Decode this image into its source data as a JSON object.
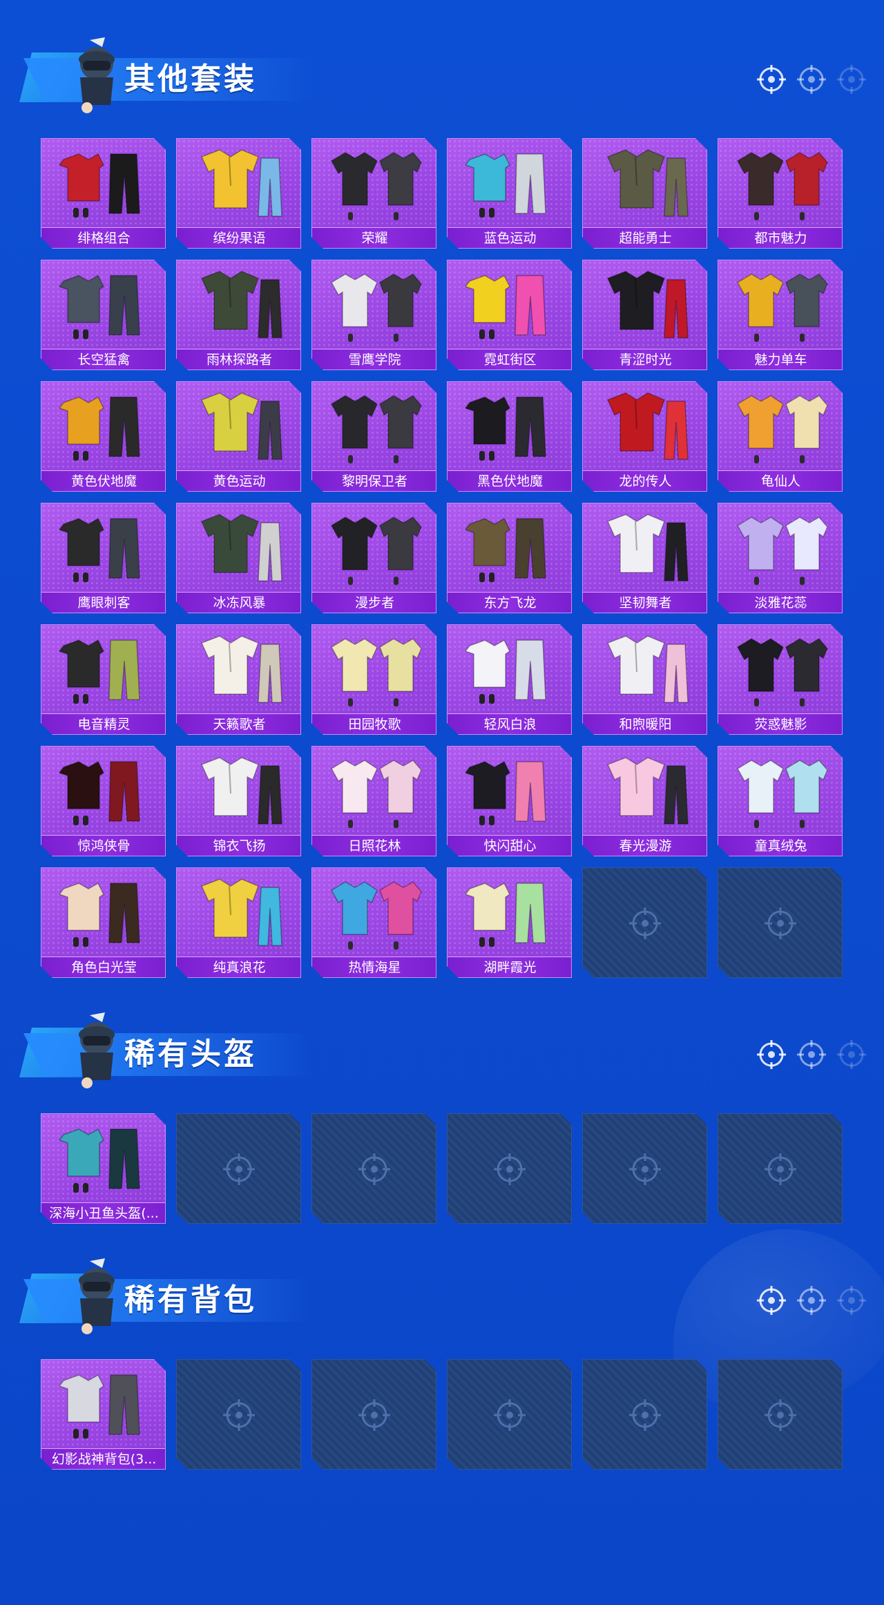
{
  "colors": {
    "background": "#0c4bd0",
    "card_filled": "#9a45e4",
    "card_label_bar": "#7a1fd0",
    "card_empty": "#1f3f78",
    "title_text": "#ffffff"
  },
  "sections": [
    {
      "title": "其他套装",
      "items": [
        {
          "name": "绯格组合",
          "palette": [
            "#c4202a",
            "#1b1b1b"
          ]
        },
        {
          "name": "缤纷果语",
          "palette": [
            "#f2c230",
            "#7ab8e8"
          ]
        },
        {
          "name": "荣耀",
          "palette": [
            "#2a2a2e",
            "#3c3c42"
          ]
        },
        {
          "name": "蓝色运动",
          "palette": [
            "#3cb8d8",
            "#d0d6dc"
          ]
        },
        {
          "name": "超能勇士",
          "palette": [
            "#5b5a44",
            "#6b6850"
          ]
        },
        {
          "name": "都市魅力",
          "palette": [
            "#3a2a2a",
            "#b8202a"
          ]
        },
        {
          "name": "长空猛禽",
          "palette": [
            "#4a5360",
            "#38404c"
          ]
        },
        {
          "name": "雨林探路者",
          "palette": [
            "#3e4a38",
            "#2c2c2c"
          ]
        },
        {
          "name": "雪鹰学院",
          "palette": [
            "#e8e8ec",
            "#3a3a3e"
          ]
        },
        {
          "name": "霓虹街区",
          "palette": [
            "#f2d020",
            "#f050b0"
          ]
        },
        {
          "name": "青涩时光",
          "palette": [
            "#1e1e22",
            "#c01828"
          ]
        },
        {
          "name": "魅力单车",
          "palette": [
            "#e8b020",
            "#48505a"
          ]
        },
        {
          "name": "黄色伏地魔",
          "palette": [
            "#e8a020",
            "#2a2a2a"
          ]
        },
        {
          "name": "黄色运动",
          "palette": [
            "#d8d040",
            "#3c3c48"
          ]
        },
        {
          "name": "黎明保卫者",
          "palette": [
            "#28282c",
            "#3a3a40"
          ]
        },
        {
          "name": "黑色伏地魔",
          "palette": [
            "#1c1c20",
            "#2a2a30"
          ]
        },
        {
          "name": "龙的传人",
          "palette": [
            "#c01a20",
            "#e03038"
          ]
        },
        {
          "name": "龟仙人",
          "palette": [
            "#f0a030",
            "#f0e0b0"
          ]
        },
        {
          "name": "鹰眼刺客",
          "palette": [
            "#2a2a2a",
            "#3a4048"
          ]
        },
        {
          "name": "冰冻风暴",
          "palette": [
            "#3a4a3a",
            "#d0d0d0"
          ]
        },
        {
          "name": "漫步者",
          "palette": [
            "#222226",
            "#3a3a40"
          ]
        },
        {
          "name": "东方飞龙",
          "palette": [
            "#6a5a3a",
            "#4a4030"
          ]
        },
        {
          "name": "坚韧舞者",
          "palette": [
            "#f0f0f4",
            "#202024"
          ]
        },
        {
          "name": "淡雅花蕊",
          "palette": [
            "#c0b0f0",
            "#e8e8ff"
          ]
        },
        {
          "name": "电音精灵",
          "palette": [
            "#2a2a2a",
            "#a0b050"
          ]
        },
        {
          "name": "天籁歌者",
          "palette": [
            "#f4f0e8",
            "#d0c8b8"
          ]
        },
        {
          "name": "田园牧歌",
          "palette": [
            "#f0e8b0",
            "#e8e0a0"
          ]
        },
        {
          "name": "轻风白浪",
          "palette": [
            "#f4f4f8",
            "#d8dce8"
          ]
        },
        {
          "name": "和煦暖阳",
          "palette": [
            "#f0f0f4",
            "#f0c0d8"
          ]
        },
        {
          "name": "荧惑魅影",
          "palette": [
            "#1c1c22",
            "#2a2a30"
          ]
        },
        {
          "name": "惊鸿侠骨",
          "palette": [
            "#2a1010",
            "#801820"
          ]
        },
        {
          "name": "锦衣飞扬",
          "palette": [
            "#f0f0f0",
            "#2a2a2a"
          ]
        },
        {
          "name": "日照花林",
          "palette": [
            "#f8e8f0",
            "#f0d0e0"
          ]
        },
        {
          "name": "快闪甜心",
          "palette": [
            "#1c1c22",
            "#f080b0"
          ]
        },
        {
          "name": "春光漫游",
          "palette": [
            "#f8c8e0",
            "#2a2a30"
          ]
        },
        {
          "name": "童真绒兔",
          "palette": [
            "#e8f0f8",
            "#b0e0f0"
          ]
        },
        {
          "name": "角色白光莹",
          "palette": [
            "#f0d8c0",
            "#3a2a20"
          ]
        },
        {
          "name": "纯真浪花",
          "palette": [
            "#f0d040",
            "#40b8e0"
          ]
        },
        {
          "name": "热情海星",
          "palette": [
            "#40a8e0",
            "#e050a0"
          ]
        },
        {
          "name": "湖畔霞光",
          "palette": [
            "#f0e8c0",
            "#a8e0a0"
          ]
        },
        {
          "name": "",
          "palette": []
        },
        {
          "name": "",
          "palette": []
        }
      ]
    },
    {
      "title": "稀有头盔",
      "items": [
        {
          "name": "深海小丑鱼头盔(...",
          "palette": [
            "#3aa8b8",
            "#1a3840"
          ]
        },
        {
          "name": "",
          "palette": []
        },
        {
          "name": "",
          "palette": []
        },
        {
          "name": "",
          "palette": []
        },
        {
          "name": "",
          "palette": []
        },
        {
          "name": "",
          "palette": []
        }
      ]
    },
    {
      "title": "稀有背包",
      "items": [
        {
          "name": "幻影战神背包(3...",
          "palette": [
            "#d8d8e0",
            "#505058"
          ]
        },
        {
          "name": "",
          "palette": []
        },
        {
          "name": "",
          "palette": []
        },
        {
          "name": "",
          "palette": []
        },
        {
          "name": "",
          "palette": []
        },
        {
          "name": "",
          "palette": []
        }
      ]
    }
  ]
}
